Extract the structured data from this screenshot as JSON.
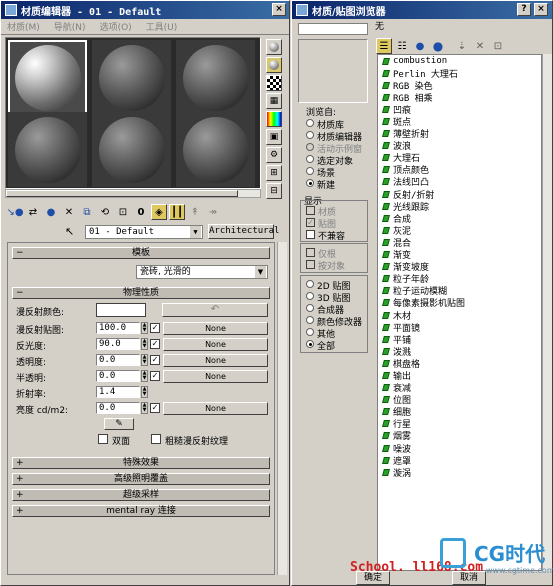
{
  "mat_editor": {
    "title": "材质编辑器 - 01 - Default",
    "menus": [
      "材质(M)",
      "导航(N)",
      "选项(O)",
      "工具(U)"
    ],
    "material_name": "01 - Default",
    "material_type": "Architectural",
    "templates_title": "模板",
    "template_value": "瓷砖, 光滑的",
    "phys_title": "物理性质",
    "props": [
      {
        "label": "漫反射颜色:"
      },
      {
        "label": "漫反射贴图:",
        "value": "100.0",
        "map": "None"
      },
      {
        "label": "反光度:",
        "value": "90.0",
        "map": "None"
      },
      {
        "label": "透明度:",
        "value": "0.0",
        "map": "None"
      },
      {
        "label": "半透明:",
        "value": "0.0",
        "map": "None"
      },
      {
        "label": "折射率:",
        "value": "1.4"
      },
      {
        "label": "亮度 cd/m2:",
        "value": "0.0",
        "map": "None"
      }
    ],
    "two_sided": "双面",
    "raw_diffuse": "粗糙漫反射纹理",
    "rollouts": [
      "特殊效果",
      "高级照明覆盖",
      "超级采样",
      "mental ray 连接"
    ]
  },
  "map_browser": {
    "title": "材质/贴图浏览器",
    "name_value": "无",
    "browse_from_title": "浏览自:",
    "browse_from": [
      {
        "label": "材质库",
        "on": false,
        "grey": false
      },
      {
        "label": "材质编辑器",
        "on": false,
        "grey": false
      },
      {
        "label": "活动示例窗",
        "on": false,
        "grey": true
      },
      {
        "label": "选定对象",
        "on": false,
        "grey": false
      },
      {
        "label": "场景",
        "on": false,
        "grey": false
      },
      {
        "label": "新建",
        "on": true,
        "grey": false
      }
    ],
    "show_title": "显示",
    "show": [
      {
        "label": "材质",
        "checked": false
      },
      {
        "label": "贴图",
        "checked": true
      },
      {
        "label": "不兼容",
        "checked": false
      }
    ],
    "show2": [
      {
        "label": "仅根",
        "checked": false
      },
      {
        "label": "按对象",
        "checked": false
      }
    ],
    "types": [
      {
        "label": "2D 贴图",
        "on": false
      },
      {
        "label": "3D 贴图",
        "on": false
      },
      {
        "label": "合成器",
        "on": false
      },
      {
        "label": "颜色修改器",
        "on": false
      },
      {
        "label": "其他",
        "on": false
      },
      {
        "label": "全部",
        "on": true
      }
    ],
    "maps": [
      "combustion",
      "Perlin 大理石",
      "RGB 染色",
      "RGB 相乘",
      "凹痕",
      "斑点",
      "薄壁折射",
      "波浪",
      "大理石",
      "顶点颜色",
      "法线凹凸",
      "反射/折射",
      "光线跟踪",
      "合成",
      "灰泥",
      "混合",
      "渐变",
      "渐变坡度",
      "粒子年龄",
      "粒子运动模糊",
      "每像素摄影机贴图",
      "木材",
      "平面镜",
      "平铺",
      "泼溅",
      "棋盘格",
      "输出",
      "衰减",
      "位图",
      "细胞",
      "行星",
      "烟雾",
      "噪波",
      "遮罩",
      "漩涡"
    ],
    "ok": "确定",
    "cancel": "取消"
  },
  "watermark": {
    "school": "School.  ll168.com",
    "brand": "CG时代",
    "site": "www.cgtime.com"
  }
}
